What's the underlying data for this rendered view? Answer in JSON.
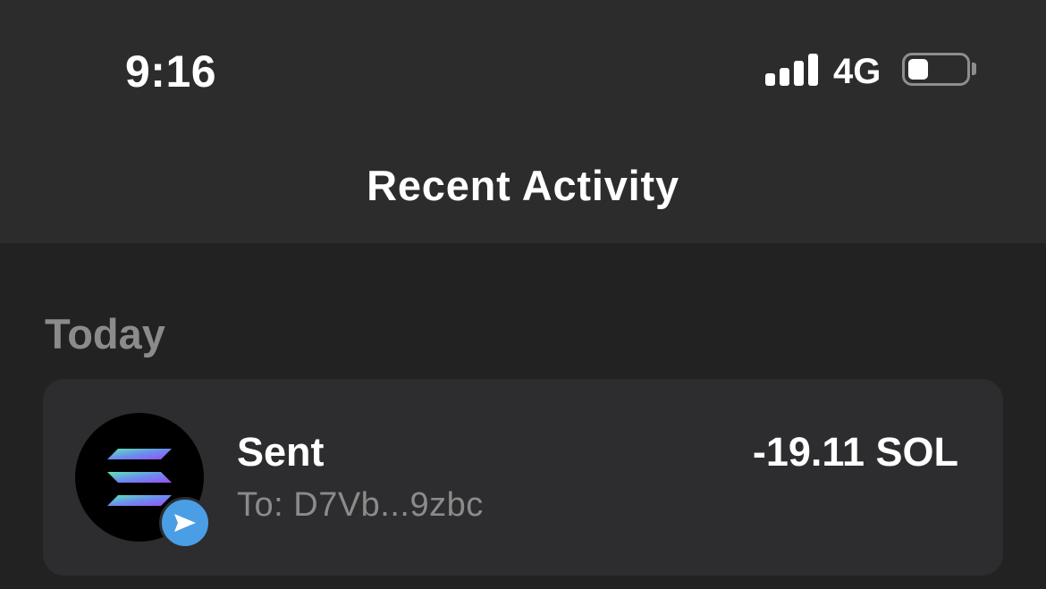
{
  "status_bar": {
    "time": "9:16",
    "network": "4G",
    "signal_bars": 4,
    "battery_level": 0.35,
    "icons": [
      "cellular-signal-icon",
      "battery-icon"
    ]
  },
  "header": {
    "title": "Recent Activity"
  },
  "sections": [
    {
      "label": "Today",
      "items": [
        {
          "title": "Sent",
          "subtitle": "To: D7Vb...9zbc",
          "amount": "-19.11 SOL",
          "token_icon": "solana-logo-icon",
          "badge_icon": "send-arrow-icon"
        }
      ]
    }
  ],
  "colors": {
    "header_bg": "#2c2c2c",
    "page_bg": "#222222",
    "card_bg": "#2d2d2f",
    "muted_text": "#8b8b8b",
    "badge_blue": "#4a9ee6"
  }
}
